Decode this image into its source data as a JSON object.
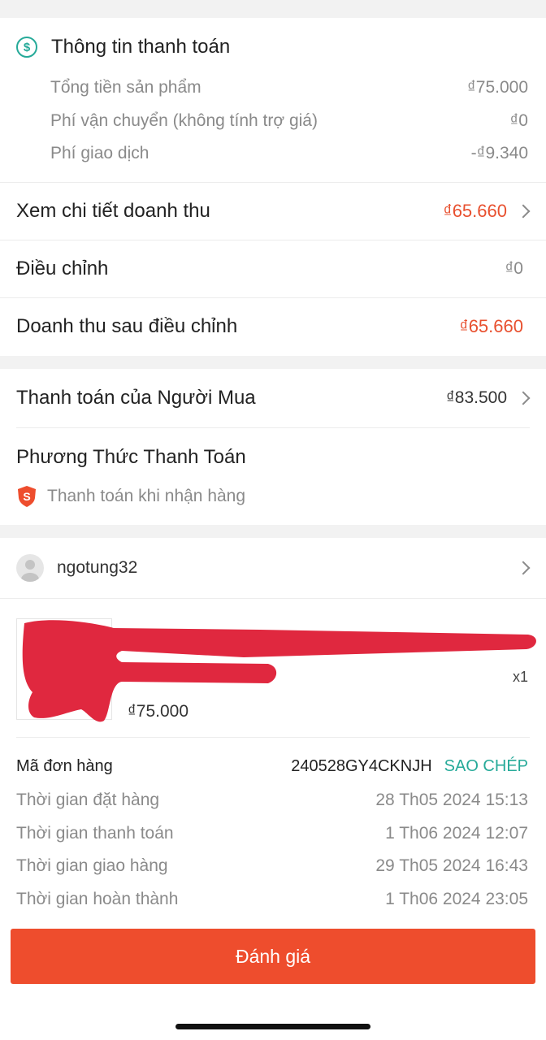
{
  "payment_info": {
    "title": "Thông tin thanh toán",
    "icon": "dollar-circle-icon",
    "lines": [
      {
        "label": "Tổng tiền sản phẩm",
        "value": "₫75.000"
      },
      {
        "label": "Phí vận chuyển (không tính trợ giá)",
        "value": "₫0"
      },
      {
        "label": "Phí giao dịch",
        "value": "-₫9.340"
      }
    ]
  },
  "revenue": {
    "detail_label": "Xem chi tiết doanh thu",
    "detail_value": "₫65.660",
    "adjust_label": "Điều chỉnh",
    "adjust_value": "₫0",
    "after_label": "Doanh thu sau điều chỉnh",
    "after_value": "₫65.660"
  },
  "buyer_payment": {
    "label": "Thanh toán của Người Mua",
    "value": "₫83.500"
  },
  "payment_method": {
    "title": "Phương Thức Thanh Toán",
    "method": "Thanh toán khi nhận hàng",
    "icon": "shield-s-icon"
  },
  "buyer": {
    "username": "ngotung32"
  },
  "product": {
    "quantity": "x1",
    "price": "₫75.000"
  },
  "order": {
    "id_label": "Mã đơn hàng",
    "id_value": "240528GY4CKNJH",
    "copy_label": "SAO CHÉP",
    "times": [
      {
        "label": "Thời gian đặt hàng",
        "value": "28 Th05 2024 15:13"
      },
      {
        "label": "Thời gian thanh toán",
        "value": "1 Th06 2024 12:07"
      },
      {
        "label": "Thời gian giao hàng",
        "value": "29 Th05 2024 16:43"
      },
      {
        "label": "Thời gian hoàn thành",
        "value": "1 Th06 2024 23:05"
      }
    ]
  },
  "footer": {
    "review_label": "Đánh giá"
  },
  "colors": {
    "accent": "#ee4d2d",
    "revenue": "#e8502f",
    "copy": "#26aa99",
    "redaction": "#e0283f"
  }
}
